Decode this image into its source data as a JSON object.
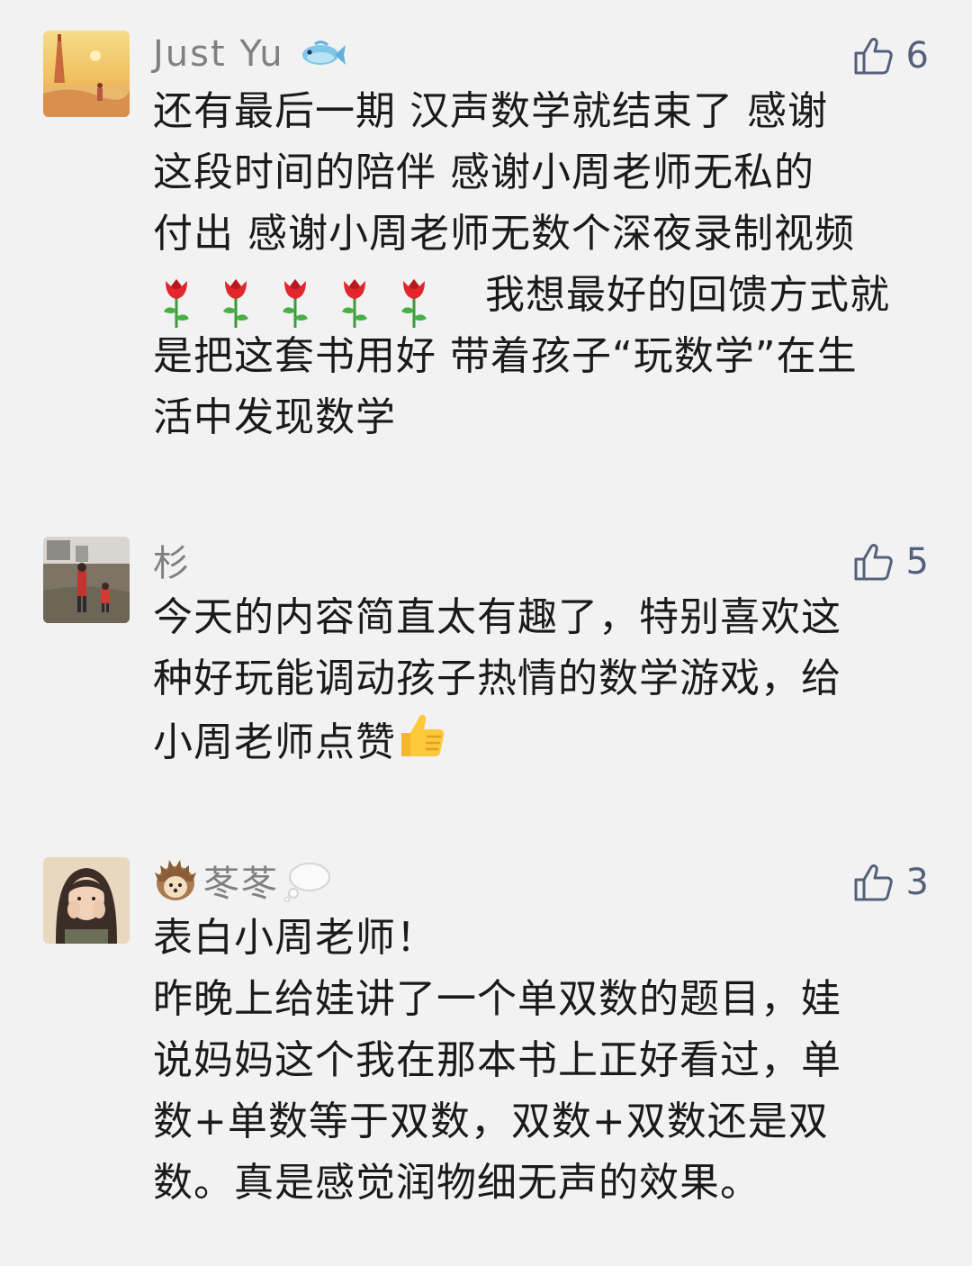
{
  "comments": [
    {
      "name": "Just Yu",
      "likes": "6",
      "lines": [
        "还有最后一期  汉声数学就结束了  感谢",
        "这段时间的陪伴  感谢小周老师无私的",
        "付出 感谢小周老师无数个深夜录制视频",
        "我想最好的回馈方式就",
        "是把这套书用好 带着孩子“玩数学”在生",
        "活中发现数学"
      ]
    },
    {
      "name": "杉",
      "likes": "5",
      "lines": [
        "今天的内容简直太有趣了，特别喜欢这",
        "种好玩能调动孩子热情的数学游戏，给",
        "小周老师点赞"
      ]
    },
    {
      "name": "苳苳",
      "likes": "3",
      "lines": [
        "表白小周老师！",
        "昨晚上给娃讲了一个单双数的题目，娃",
        "说妈妈这个我在那本书上正好看过，单",
        "数+单数等于双数，双数+双数还是双",
        "数。真是感觉润物细无声的效果。"
      ]
    }
  ],
  "icons": {
    "like": "thumbs-up-outline-icon",
    "fish": "fish-emoji-icon",
    "rose": "rose-emoji-icon",
    "thumbs_up_emoji": "thumbs-up-emoji-icon",
    "hedgehog": "hedgehog-emoji-icon",
    "thought_bubble": "thought-bubble-emoji-icon"
  },
  "colors": {
    "background": "#f2f2f2",
    "name": "#808080",
    "like": "#55607a",
    "text": "#1a1a1a"
  }
}
